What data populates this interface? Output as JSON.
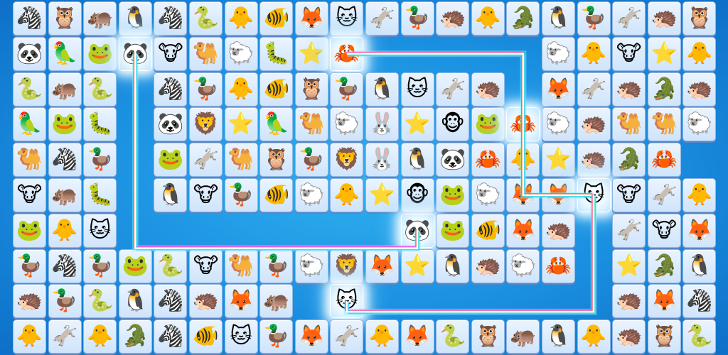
{
  "game": {
    "grid": [
      [
        "zebra",
        "owl",
        "hippo",
        "penguin",
        "zebra",
        "snake",
        "chick",
        "fish",
        "fox",
        "cat",
        "donkey",
        "duck",
        "hedgehog",
        "chick",
        "crocodile",
        "penguin",
        "duck",
        "donkey",
        "hedgehog",
        "owl"
      ],
      [
        "panda",
        "parrot",
        "frog",
        "panda",
        "cow",
        "camel",
        "sheep",
        "worm",
        "starfish",
        "crab",
        "",
        "",
        "",
        "",
        "",
        "sheep",
        "chick",
        "cow",
        "starfish",
        "chick"
      ],
      [
        "snake",
        "hippo",
        "snake",
        "",
        "zebra",
        "duck",
        "chick",
        "fish",
        "owl",
        "duck",
        "penguin",
        "cat",
        "donkey",
        "hedgehog",
        "",
        "fox",
        "donkey",
        "hedgehog",
        "crocodile",
        "hedgehog"
      ],
      [
        "parrot",
        "frog",
        "worm",
        "",
        "panda",
        "lion",
        "starfish",
        "parrot",
        "camel",
        "sheep",
        "rabbit",
        "starfish",
        "monkey",
        "frog",
        "crab",
        "sheep",
        "hedgehog",
        "camel",
        "camel",
        "sheep"
      ],
      [
        "camel",
        "zebra",
        "duck",
        "",
        "frog",
        "donkey",
        "camel",
        "owl",
        "duck",
        "lion",
        "rabbit",
        "penguin",
        "panda",
        "crab",
        "chick",
        "starfish",
        "hedgehog",
        "crocodile",
        "crab",
        ""
      ],
      [
        "cow",
        "hippo",
        "worm",
        "",
        "penguin",
        "cow",
        "duck",
        "fish",
        "sheep",
        "chick",
        "starfish",
        "monkey",
        "frog",
        "sheep",
        "fox",
        "fox",
        "cat",
        "cow",
        "donkey",
        "chick"
      ],
      [
        "frog",
        "chick",
        "cat",
        "",
        "",
        "",
        "",
        "",
        "",
        "",
        "",
        "panda",
        "frog",
        "fish",
        "fox",
        "hedgehog",
        "",
        "donkey",
        "cow",
        "fox"
      ],
      [
        "duck",
        "zebra",
        "duck",
        "frog",
        "snake",
        "cow",
        "camel",
        "duck",
        "sheep",
        "lion",
        "fox",
        "starfish",
        "penguin",
        "hedgehog",
        "sheep",
        "crab",
        "",
        "starfish",
        "crocodile",
        "penguin"
      ],
      [
        "hedgehog",
        "duck",
        "snake",
        "penguin",
        "zebra",
        "hedgehog",
        "fox",
        "hippo",
        "",
        "cat",
        "",
        "",
        "",
        "",
        "",
        "",
        "",
        "hedgehog",
        "fox",
        "zebra"
      ],
      [
        "chick",
        "donkey",
        "chick",
        "crocodile",
        "zebra",
        "fish",
        "cat",
        "duck",
        "fox",
        "donkey",
        "chick",
        "fox",
        "snake",
        "owl",
        "hippo",
        "penguin",
        "chick",
        "hedgehog",
        "owl",
        "snake"
      ]
    ],
    "flash_tiles": [
      [
        1,
        3
      ],
      [
        1,
        9
      ],
      [
        3,
        14
      ],
      [
        5,
        16
      ],
      [
        6,
        11
      ],
      [
        8,
        9
      ]
    ]
  },
  "icons": {
    "zebra": "🦓",
    "owl": "🦉",
    "hippo": "🦛",
    "penguin": "🐧",
    "snake": "🐍",
    "chick": "🐥",
    "fish": "🐠",
    "fox": "🦊",
    "cat": "🐱",
    "donkey": "🫏",
    "duck": "🦆",
    "hedgehog": "🦔",
    "crocodile": "🐊",
    "panda": "🐼",
    "parrot": "🦜",
    "frog": "🐸",
    "cow": "🐮",
    "camel": "🐫",
    "sheep": "🐑",
    "worm": "🐛",
    "starfish": "⭐",
    "crab": "🦀",
    "lion": "🦁",
    "rabbit": "🐰",
    "monkey": "🐵"
  },
  "colors": {
    "beam_primary": "#ffffff",
    "beam_glow": "#7fe8ff",
    "beam_rainbow": [
      "#ff4fd8",
      "#ffe14f",
      "#4fff9a",
      "#4fd0ff"
    ]
  }
}
